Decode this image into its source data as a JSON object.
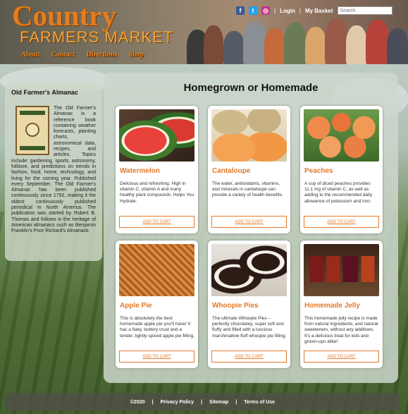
{
  "header": {
    "logo_line1": "Country",
    "logo_line2": "FARMERS MARKET",
    "nav": [
      "About",
      "Contact",
      "Directions",
      "Shop"
    ],
    "social_icons": [
      "facebook-icon",
      "twitter-icon",
      "instagram-icon"
    ],
    "login_label": "Login",
    "basket_label": "My Basket",
    "search_placeholder": "Search"
  },
  "sidebar": {
    "title": "Old Farmer's Almanac",
    "body": "The Old Farmer's Almanac is a reference book containing weather forecasts, planting charts, astronomical data, recipes, and articles. Topics include: gardening, sports, astronomy, folklore, and predictions on trends in fashion, food, home, technology, and living for the coming year. Published every September, The Old Farmer's Almanac has been published continuously since 1792, making it the oldest continuously published periodical in North America. The publication was started by Robert B. Thomas and follows in the heritage of American almanacs such as Benjamin Franklin's Poor Richard's Almanack."
  },
  "main": {
    "title": "Homegrown or Homemade",
    "button_label": "ADD TO CART",
    "products": [
      {
        "name": "Watermelon",
        "desc": "Delicious and refreshing. High in vitamin C, vitamin A and many healthy plant compounds. Helps You Hydrate."
      },
      {
        "name": "Cantaloupe",
        "desc": "The water, antioxidants, vitamins, and minerals in cantaloupe can provide a variety of health benefits."
      },
      {
        "name": "Peaches",
        "desc": "A cup of diced peaches provides 11.1 mg of vitamin C, as well as adding to the recommended daily allowance of potassium and iron."
      },
      {
        "name": "Apple Pie",
        "desc": "This is absolutely the best homemade apple pie you'll have! It has a flaky, buttery crust and a tender, lightly-spiced apple pie filling."
      },
      {
        "name": "Whoopie Pies",
        "desc": "The ultimate Whoopie Pies – perfectly chocolatey, super soft and fluffy and filled with a luscious marshmallow fluff whoopie pie filling."
      },
      {
        "name": "Homemade Jelly",
        "desc": "This homemade jelly recipe is made from natural ingredients, and natural sweeteners, without any additives. It's a delicious treat for kids and grown-ups alike!"
      }
    ]
  },
  "footer": {
    "copyright": "©2020",
    "links": [
      "Privacy Policy",
      "Sitemap",
      "Terms of Use"
    ]
  },
  "colors": {
    "accent": "#e07a2c",
    "logo": "#e57d1c"
  }
}
